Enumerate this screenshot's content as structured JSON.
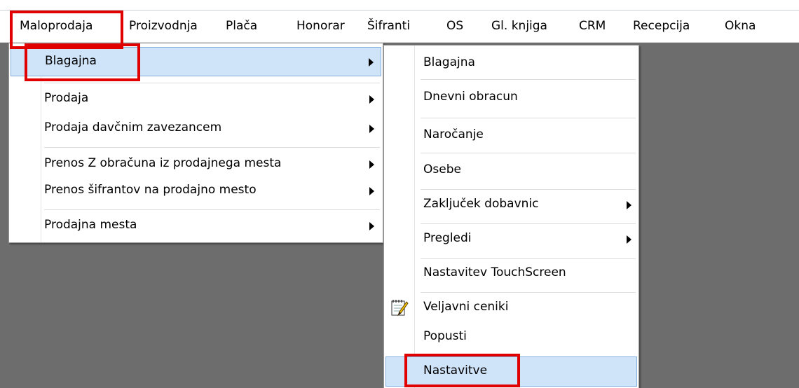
{
  "menubar": {
    "items": [
      {
        "label": "Maloprodaja"
      },
      {
        "label": "Proizvodnja"
      },
      {
        "label": "Plača"
      },
      {
        "label": "Honorar"
      },
      {
        "label": "Šifranti"
      },
      {
        "label": "OS"
      },
      {
        "label": "Gl. knjiga"
      },
      {
        "label": "CRM"
      },
      {
        "label": "Recepcija"
      },
      {
        "label": "Okna"
      }
    ]
  },
  "maloprodaja_menu": {
    "items": [
      {
        "label": "Blagajna"
      },
      {
        "label": "Prodaja"
      },
      {
        "label": "Prodaja davčnim zavezancem"
      },
      {
        "label": "Prenos Z obračuna iz prodajnega mesta"
      },
      {
        "label": "Prenos šifrantov na prodajno mesto"
      },
      {
        "label": "Prodajna mesta"
      }
    ]
  },
  "blagajna_submenu": {
    "items": [
      {
        "label": "Blagajna"
      },
      {
        "label": "Dnevni obracun"
      },
      {
        "label": "Naročanje"
      },
      {
        "label": "Osebe"
      },
      {
        "label": "Zaključek dobavnic"
      },
      {
        "label": "Pregledi"
      },
      {
        "label": "Nastavitev TouchScreen"
      },
      {
        "label": "Veljavni ceniki",
        "icon": "notepad-pencil-icon"
      },
      {
        "label": "Popusti"
      },
      {
        "label": "Nastavitve"
      }
    ]
  },
  "colors": {
    "highlight": "#cfe3f9",
    "highlight_border": "#84acdd",
    "annotation_red": "#e10000",
    "background": "#6d6d6d"
  }
}
